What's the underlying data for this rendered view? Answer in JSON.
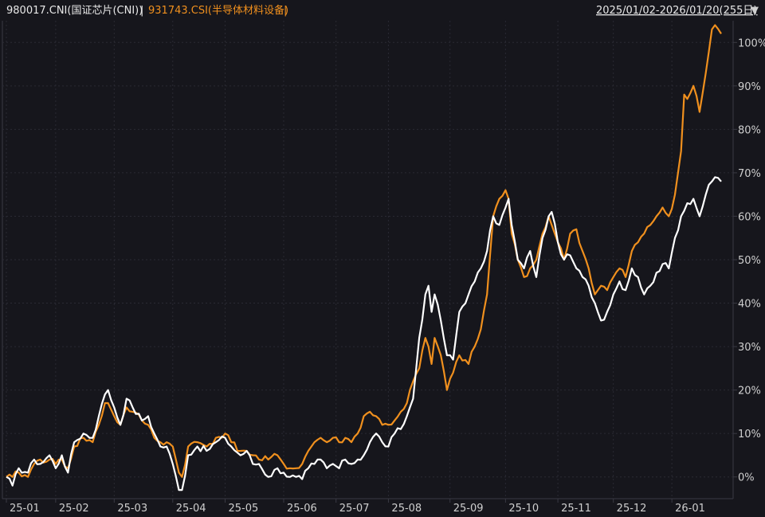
{
  "header": {
    "series1_label": "980017.CNI(国证芯片(CNI))",
    "separator": " | ",
    "series2_label": "931743.CSI(半导体材料设备)",
    "separator2": " |",
    "range_label": "2025/01/02-2026/01/20(255日)",
    "dropdown_glyph": "▼"
  },
  "colors": {
    "background": "#16161c",
    "series1": "#ffffff",
    "series2": "#f0901e",
    "header_series1": "#e8e8e8",
    "header_series2": "#f0901e"
  },
  "chart_data": {
    "type": "line",
    "x_ticks": [
      "25-01",
      "25-02",
      "25-03",
      "25-04",
      "25-05",
      "25-06",
      "25-07",
      "25-08",
      "25-09",
      "25-10",
      "25-11",
      "25-12",
      "26-01"
    ],
    "y_ticks": [
      "0%",
      "10%",
      "20%",
      "30%",
      "40%",
      "50%",
      "60%",
      "70%",
      "80%",
      "90%",
      "100%"
    ],
    "ylim": [
      -5,
      105
    ],
    "y_tick_values": [
      0,
      10,
      20,
      30,
      40,
      50,
      60,
      70,
      80,
      90,
      100
    ],
    "x_tick_index": [
      0,
      16,
      35,
      54,
      71,
      90,
      107,
      124,
      144,
      162,
      179,
      197,
      216
    ],
    "n_points": 255,
    "series": [
      {
        "name": "980017.CNI(国证芯片(CNI))",
        "color": "#ffffff",
        "keypoints": [
          [
            0,
            0
          ],
          [
            2,
            -2
          ],
          [
            4,
            2
          ],
          [
            7,
            1
          ],
          [
            9,
            4
          ],
          [
            11,
            3
          ],
          [
            14,
            5
          ],
          [
            16,
            2
          ],
          [
            18,
            5
          ],
          [
            20,
            1
          ],
          [
            22,
            8
          ],
          [
            25,
            10
          ],
          [
            28,
            9
          ],
          [
            30,
            14
          ],
          [
            32,
            19
          ],
          [
            33,
            20
          ],
          [
            35,
            16
          ],
          [
            37,
            12
          ],
          [
            39,
            18
          ],
          [
            41,
            16
          ],
          [
            44,
            13
          ],
          [
            46,
            14
          ],
          [
            48,
            10
          ],
          [
            50,
            7
          ],
          [
            52,
            7
          ],
          [
            54,
            3
          ],
          [
            56,
            -3
          ],
          [
            57,
            -3
          ],
          [
            59,
            5
          ],
          [
            62,
            7
          ],
          [
            65,
            6
          ],
          [
            68,
            8
          ],
          [
            71,
            9
          ],
          [
            73,
            7
          ],
          [
            76,
            5
          ],
          [
            78,
            6
          ],
          [
            80,
            3
          ],
          [
            82,
            3
          ],
          [
            85,
            0
          ],
          [
            88,
            2
          ],
          [
            90,
            1
          ],
          [
            92,
            0
          ],
          [
            94,
            0
          ],
          [
            96,
            -0.5
          ],
          [
            98,
            2
          ],
          [
            100,
            3
          ],
          [
            102,
            4
          ],
          [
            104,
            2
          ],
          [
            106,
            3
          ],
          [
            108,
            2
          ],
          [
            110,
            4
          ],
          [
            112,
            3
          ],
          [
            114,
            4
          ],
          [
            116,
            5
          ],
          [
            118,
            8
          ],
          [
            120,
            10
          ],
          [
            122,
            8
          ],
          [
            124,
            7
          ],
          [
            126,
            10
          ],
          [
            128,
            11
          ],
          [
            130,
            14
          ],
          [
            132,
            18
          ],
          [
            134,
            32
          ],
          [
            136,
            42
          ],
          [
            137,
            44
          ],
          [
            138,
            38
          ],
          [
            139,
            42
          ],
          [
            141,
            36
          ],
          [
            143,
            28
          ],
          [
            145,
            27
          ],
          [
            147,
            38
          ],
          [
            150,
            42
          ],
          [
            152,
            45
          ],
          [
            154,
            48
          ],
          [
            156,
            52
          ],
          [
            158,
            60
          ],
          [
            160,
            58
          ],
          [
            162,
            62
          ],
          [
            163,
            64
          ],
          [
            164,
            58
          ],
          [
            166,
            50
          ],
          [
            168,
            48
          ],
          [
            170,
            52
          ],
          [
            172,
            46
          ],
          [
            174,
            55
          ],
          [
            176,
            60
          ],
          [
            177,
            61
          ],
          [
            179,
            54
          ],
          [
            181,
            50
          ],
          [
            183,
            51
          ],
          [
            185,
            48
          ],
          [
            187,
            46
          ],
          [
            189,
            44
          ],
          [
            191,
            40
          ],
          [
            193,
            36
          ],
          [
            195,
            38
          ],
          [
            197,
            42
          ],
          [
            199,
            45
          ],
          [
            201,
            43
          ],
          [
            203,
            48
          ],
          [
            205,
            46
          ],
          [
            207,
            42
          ],
          [
            209,
            44
          ],
          [
            211,
            47
          ],
          [
            213,
            49
          ],
          [
            215,
            48
          ],
          [
            217,
            55
          ],
          [
            219,
            60
          ],
          [
            221,
            63
          ],
          [
            223,
            64
          ],
          [
            225,
            60
          ],
          [
            227,
            65
          ],
          [
            229,
            68
          ],
          [
            230,
            69
          ],
          [
            232,
            68
          ]
        ]
      },
      {
        "name": "931743.CSI(半导体材料设备)",
        "color": "#f0901e",
        "keypoints": [
          [
            0,
            0
          ],
          [
            2,
            0
          ],
          [
            4,
            1
          ],
          [
            7,
            0
          ],
          [
            9,
            3
          ],
          [
            11,
            4
          ],
          [
            14,
            4
          ],
          [
            16,
            3
          ],
          [
            18,
            4
          ],
          [
            20,
            2
          ],
          [
            22,
            7
          ],
          [
            25,
            9
          ],
          [
            28,
            8
          ],
          [
            30,
            12
          ],
          [
            32,
            17
          ],
          [
            33,
            17
          ],
          [
            35,
            14
          ],
          [
            37,
            12
          ],
          [
            39,
            16
          ],
          [
            41,
            15
          ],
          [
            44,
            13
          ],
          [
            46,
            12
          ],
          [
            48,
            9
          ],
          [
            50,
            8
          ],
          [
            52,
            8
          ],
          [
            54,
            7
          ],
          [
            56,
            1
          ],
          [
            57,
            0
          ],
          [
            59,
            7
          ],
          [
            62,
            8
          ],
          [
            65,
            7
          ],
          [
            68,
            9
          ],
          [
            71,
            10
          ],
          [
            73,
            8
          ],
          [
            76,
            6
          ],
          [
            78,
            6
          ],
          [
            80,
            5
          ],
          [
            82,
            4
          ],
          [
            85,
            4
          ],
          [
            88,
            5
          ],
          [
            90,
            3
          ],
          [
            92,
            2
          ],
          [
            94,
            2
          ],
          [
            96,
            3
          ],
          [
            98,
            6
          ],
          [
            100,
            8
          ],
          [
            102,
            9
          ],
          [
            104,
            8
          ],
          [
            106,
            9
          ],
          [
            108,
            8
          ],
          [
            110,
            9
          ],
          [
            112,
            8
          ],
          [
            114,
            10
          ],
          [
            116,
            14
          ],
          [
            118,
            15
          ],
          [
            120,
            14
          ],
          [
            122,
            12
          ],
          [
            124,
            12
          ],
          [
            126,
            13
          ],
          [
            128,
            15
          ],
          [
            130,
            17
          ],
          [
            132,
            22
          ],
          [
            134,
            25
          ],
          [
            136,
            32
          ],
          [
            137,
            30
          ],
          [
            138,
            26
          ],
          [
            139,
            32
          ],
          [
            141,
            28
          ],
          [
            143,
            20
          ],
          [
            145,
            24
          ],
          [
            147,
            28
          ],
          [
            150,
            26
          ],
          [
            152,
            30
          ],
          [
            154,
            34
          ],
          [
            156,
            42
          ],
          [
            158,
            60
          ],
          [
            160,
            64
          ],
          [
            162,
            66
          ],
          [
            163,
            64
          ],
          [
            164,
            56
          ],
          [
            166,
            50
          ],
          [
            168,
            46
          ],
          [
            170,
            48
          ],
          [
            172,
            50
          ],
          [
            174,
            56
          ],
          [
            176,
            60
          ],
          [
            177,
            58
          ],
          [
            179,
            54
          ],
          [
            181,
            50
          ],
          [
            183,
            56
          ],
          [
            185,
            57
          ],
          [
            187,
            52
          ],
          [
            189,
            48
          ],
          [
            191,
            42
          ],
          [
            193,
            44
          ],
          [
            195,
            43
          ],
          [
            197,
            46
          ],
          [
            199,
            48
          ],
          [
            201,
            46
          ],
          [
            203,
            52
          ],
          [
            205,
            54
          ],
          [
            207,
            56
          ],
          [
            209,
            58
          ],
          [
            211,
            60
          ],
          [
            213,
            62
          ],
          [
            215,
            60
          ],
          [
            217,
            65
          ],
          [
            219,
            75
          ],
          [
            220,
            88
          ],
          [
            221,
            87
          ],
          [
            223,
            90
          ],
          [
            225,
            84
          ],
          [
            227,
            93
          ],
          [
            229,
            103
          ],
          [
            230,
            104
          ],
          [
            232,
            102
          ]
        ]
      }
    ]
  }
}
